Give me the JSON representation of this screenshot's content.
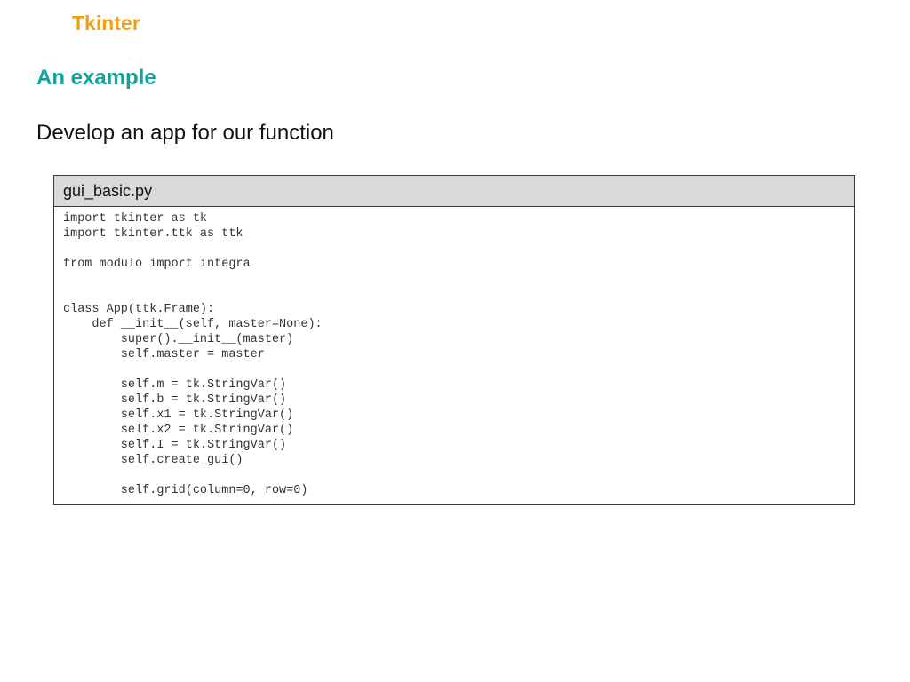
{
  "header": {
    "title": "Tkinter"
  },
  "section": {
    "title": "An example"
  },
  "subtitle": "Develop an app for our function",
  "code": {
    "filename": "gui_basic.py",
    "source": "import tkinter as tk\nimport tkinter.ttk as ttk\n\nfrom modulo import integra\n\n\nclass App(ttk.Frame):\n    def __init__(self, master=None):\n        super().__init__(master)\n        self.master = master\n\n        self.m = tk.StringVar()\n        self.b = tk.StringVar()\n        self.x1 = tk.StringVar()\n        self.x2 = tk.StringVar()\n        self.I = tk.StringVar()\n        self.create_gui()\n\n        self.grid(column=0, row=0)"
  },
  "colors": {
    "header_accent": "#f0a01a",
    "section_accent": "#14a29a",
    "code_header_bg": "#d9d9d9"
  }
}
